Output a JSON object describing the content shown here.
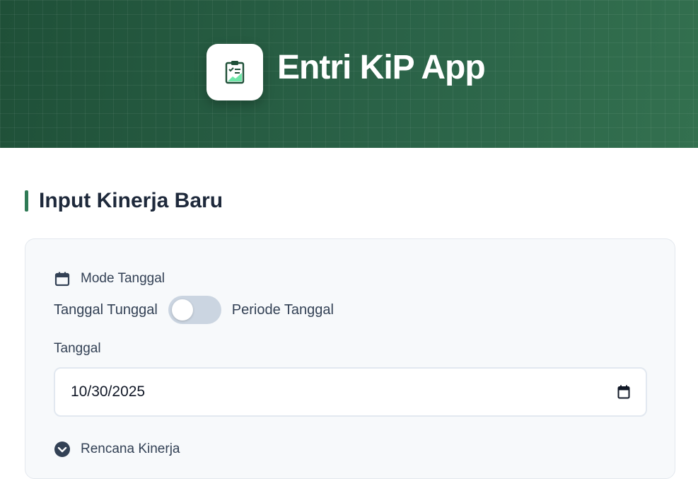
{
  "header": {
    "app_title": "Entri KiP App",
    "logo_icon": "clipboard-chart-icon"
  },
  "section": {
    "title": "Input Kinerja Baru"
  },
  "form": {
    "date_mode": {
      "label": "Mode Tanggal",
      "icon": "calendar-icon",
      "option_single": "Tanggal Tunggal",
      "option_range": "Periode Tanggal",
      "toggle_on": false
    },
    "date_field": {
      "label": "Tanggal",
      "value": "10/30/2025",
      "icon": "calendar-icon"
    },
    "plan": {
      "label": "Rencana Kinerja",
      "icon": "chevron-down-circle-icon"
    }
  },
  "colors": {
    "header_green": "#275a41",
    "accent": "#2f7a55",
    "text_dark": "#1e293b"
  }
}
